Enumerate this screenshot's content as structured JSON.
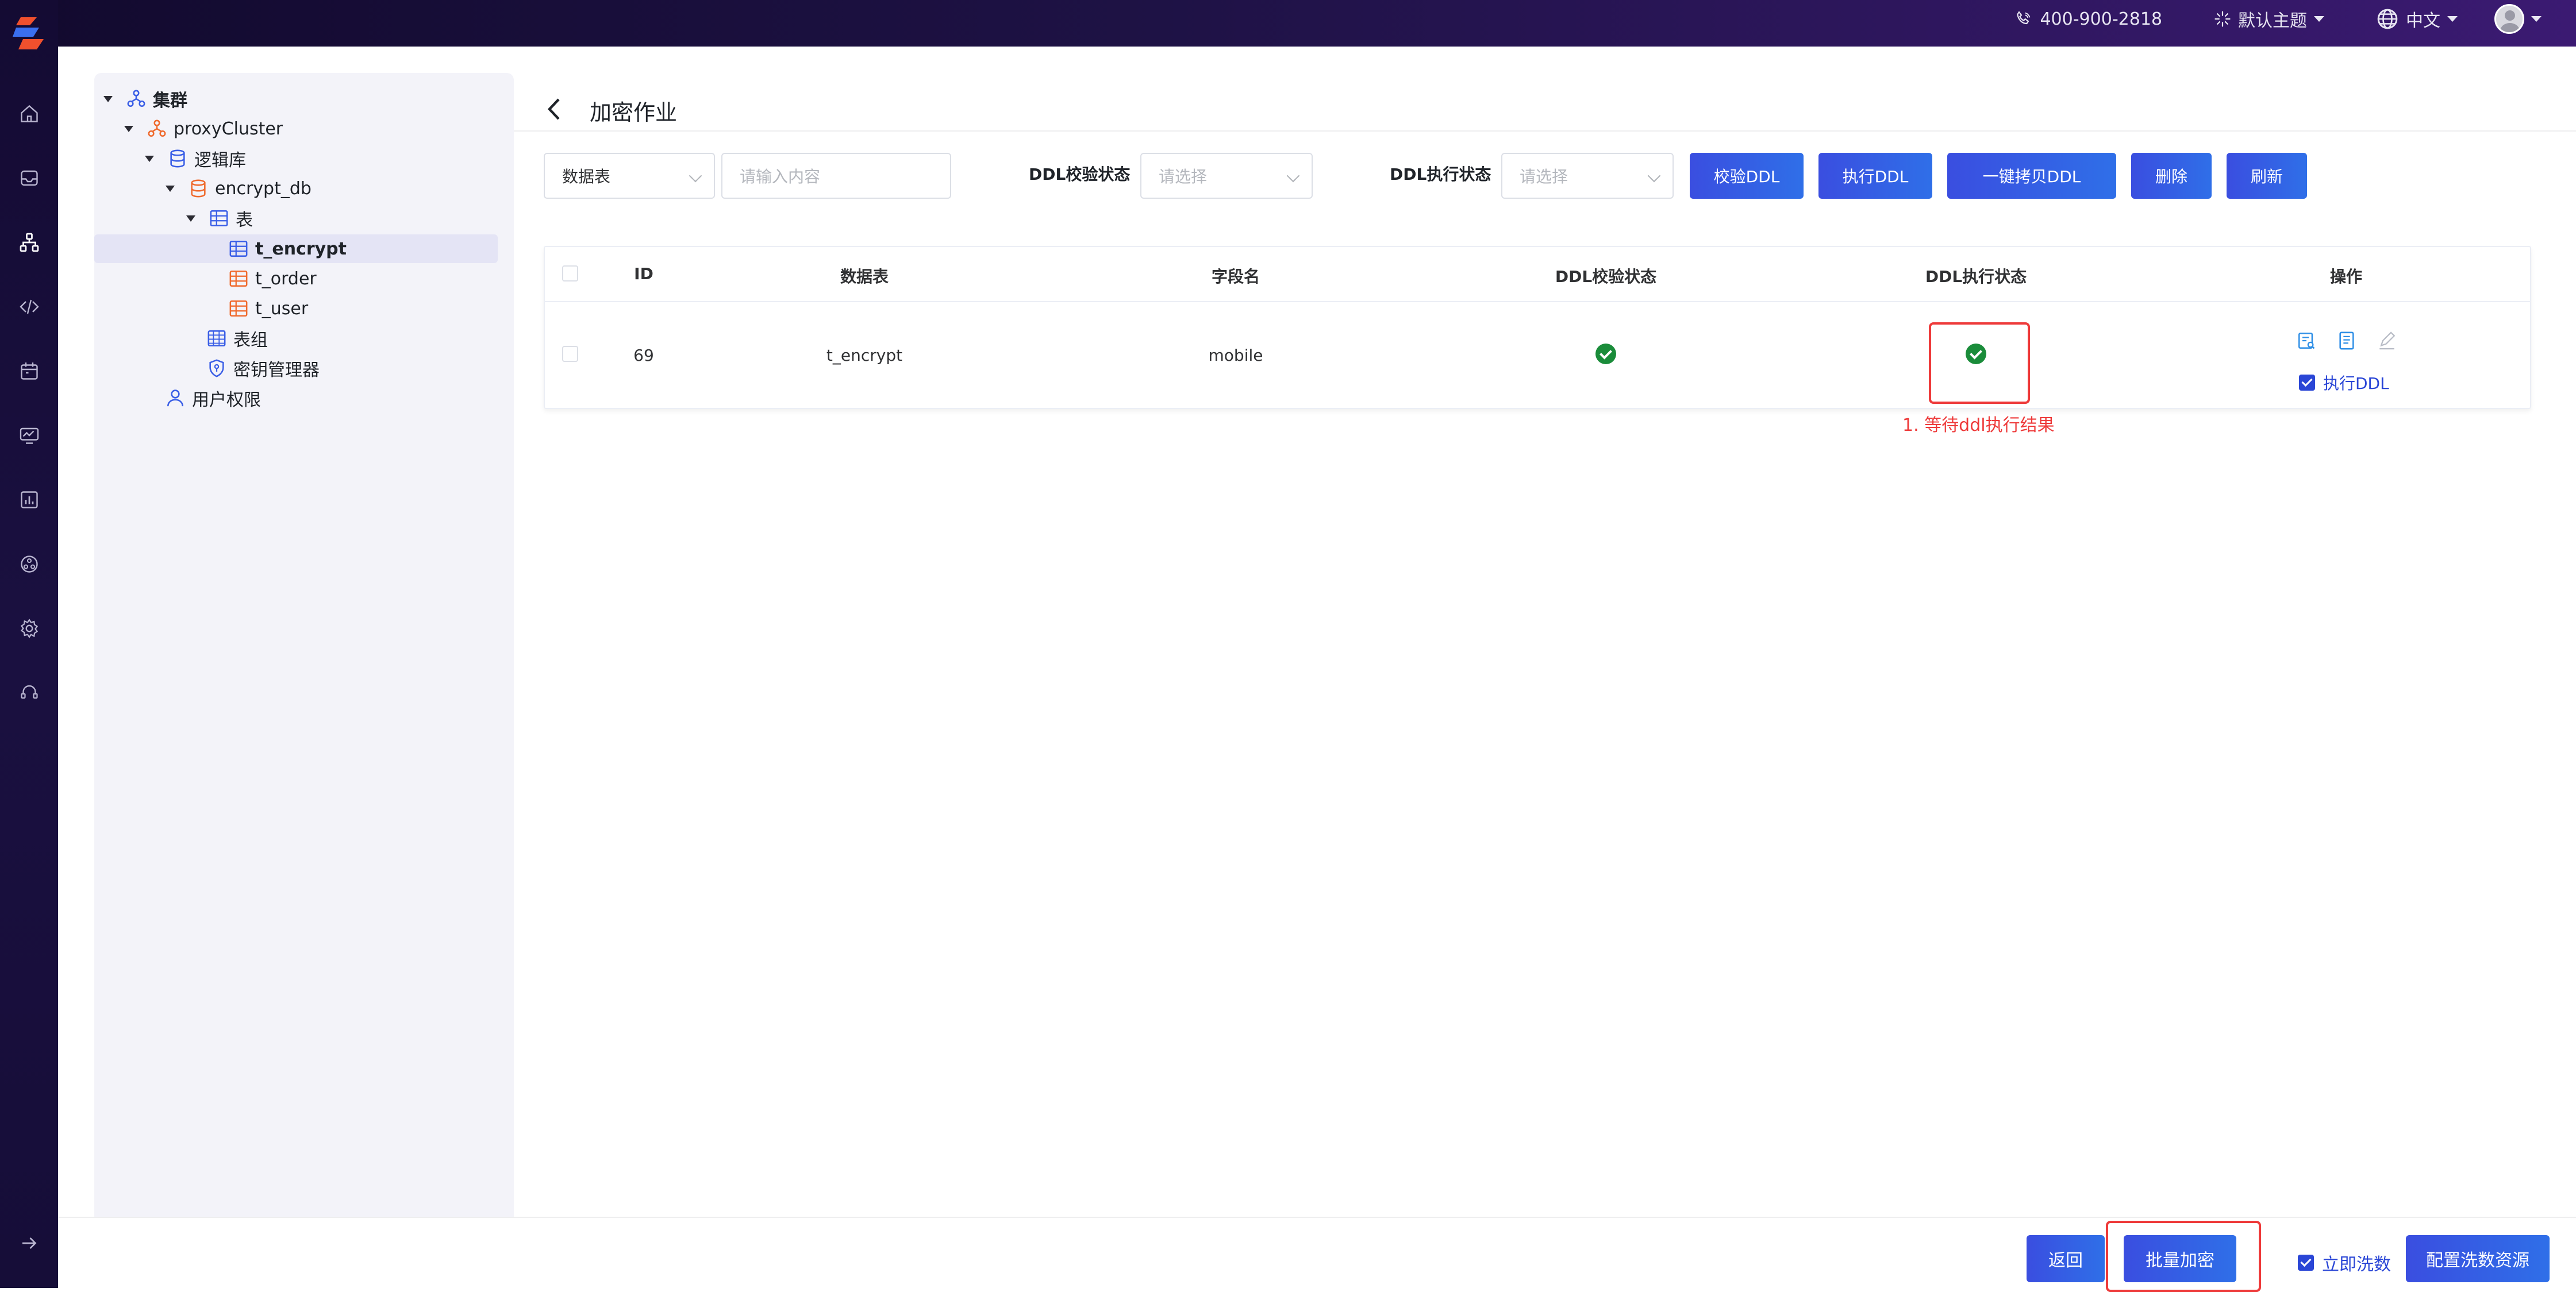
{
  "header": {
    "phone": "400-900-2818",
    "theme_label": "默认主题",
    "language_label": "中文",
    "icons": [
      "phone-icon",
      "theme-icon",
      "globe-icon",
      "avatar"
    ]
  },
  "rail": {
    "icons": [
      "home-icon",
      "inbox-icon",
      "cluster-icon",
      "code-icon",
      "calendar-icon",
      "monitor-icon",
      "chart-icon",
      "network-icon",
      "gear-icon",
      "headset-icon",
      "expand-icon"
    ]
  },
  "tree": {
    "root": "集群",
    "cluster": "proxyCluster",
    "logic_db": "逻辑库",
    "db": "encrypt_db",
    "tables_label": "表",
    "tables": [
      "t_encrypt",
      "t_order",
      "t_user"
    ],
    "table_group": "表组",
    "key_manager": "密钥管理器",
    "user_perm": "用户权限"
  },
  "page": {
    "title": "加密作业"
  },
  "filters": {
    "field_select": "数据表",
    "search_placeholder": "请输入内容",
    "ddl_check_label": "DDL校验状态",
    "ddl_check_placeholder": "请选择",
    "ddl_exec_label": "DDL执行状态",
    "ddl_exec_placeholder": "请选择",
    "buttons": {
      "check_ddl": "校验DDL",
      "exec_ddl": "执行DDL",
      "copy_ddl": "一键拷贝DDL",
      "delete": "删除",
      "refresh": "刷新"
    }
  },
  "table": {
    "headers": [
      "ID",
      "数据表",
      "字段名",
      "DDL校验状态",
      "DDL执行状态",
      "操作"
    ],
    "rows": [
      {
        "id": "69",
        "table": "t_encrypt",
        "field": "mobile",
        "check_status": "success",
        "exec_status": "success",
        "op_check_label": "执行DDL"
      }
    ]
  },
  "annotation": {
    "text": "1. 等待ddl执行结果"
  },
  "footer": {
    "back": "返回",
    "batch_encrypt": "批量加密",
    "wash_now": "立即洗数",
    "config_wash": "配置洗数资源"
  },
  "colors": {
    "accent": "#2f5ae6",
    "success": "#1a8c3a",
    "highlight": "#ee3a3a",
    "tree_bg": "#f3f3f9"
  }
}
